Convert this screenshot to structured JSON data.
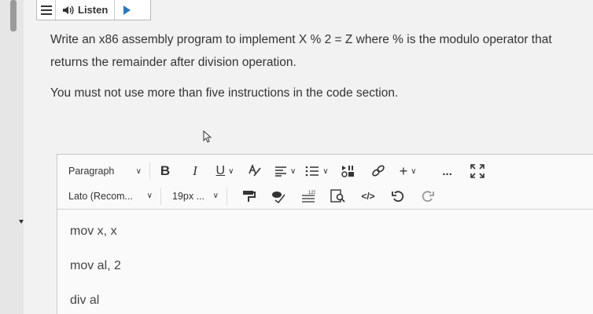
{
  "listen": {
    "label": "Listen"
  },
  "question": {
    "text": "Write an x86 assembly program to implement X % 2 = Z where % is the modulo operator that returns the remainder after division operation.",
    "constraint": "You must not use more than five instructions in the code section."
  },
  "editor": {
    "paragraph_select": "Paragraph",
    "font_select": "Lato (Recom...",
    "size_select": "19px ...",
    "lines": [
      "mov x, x",
      "mov al, 2",
      "div al"
    ]
  },
  "icons": {
    "bold": "B",
    "italic": "I",
    "underline": "U",
    "more": "...",
    "plus": "+"
  }
}
